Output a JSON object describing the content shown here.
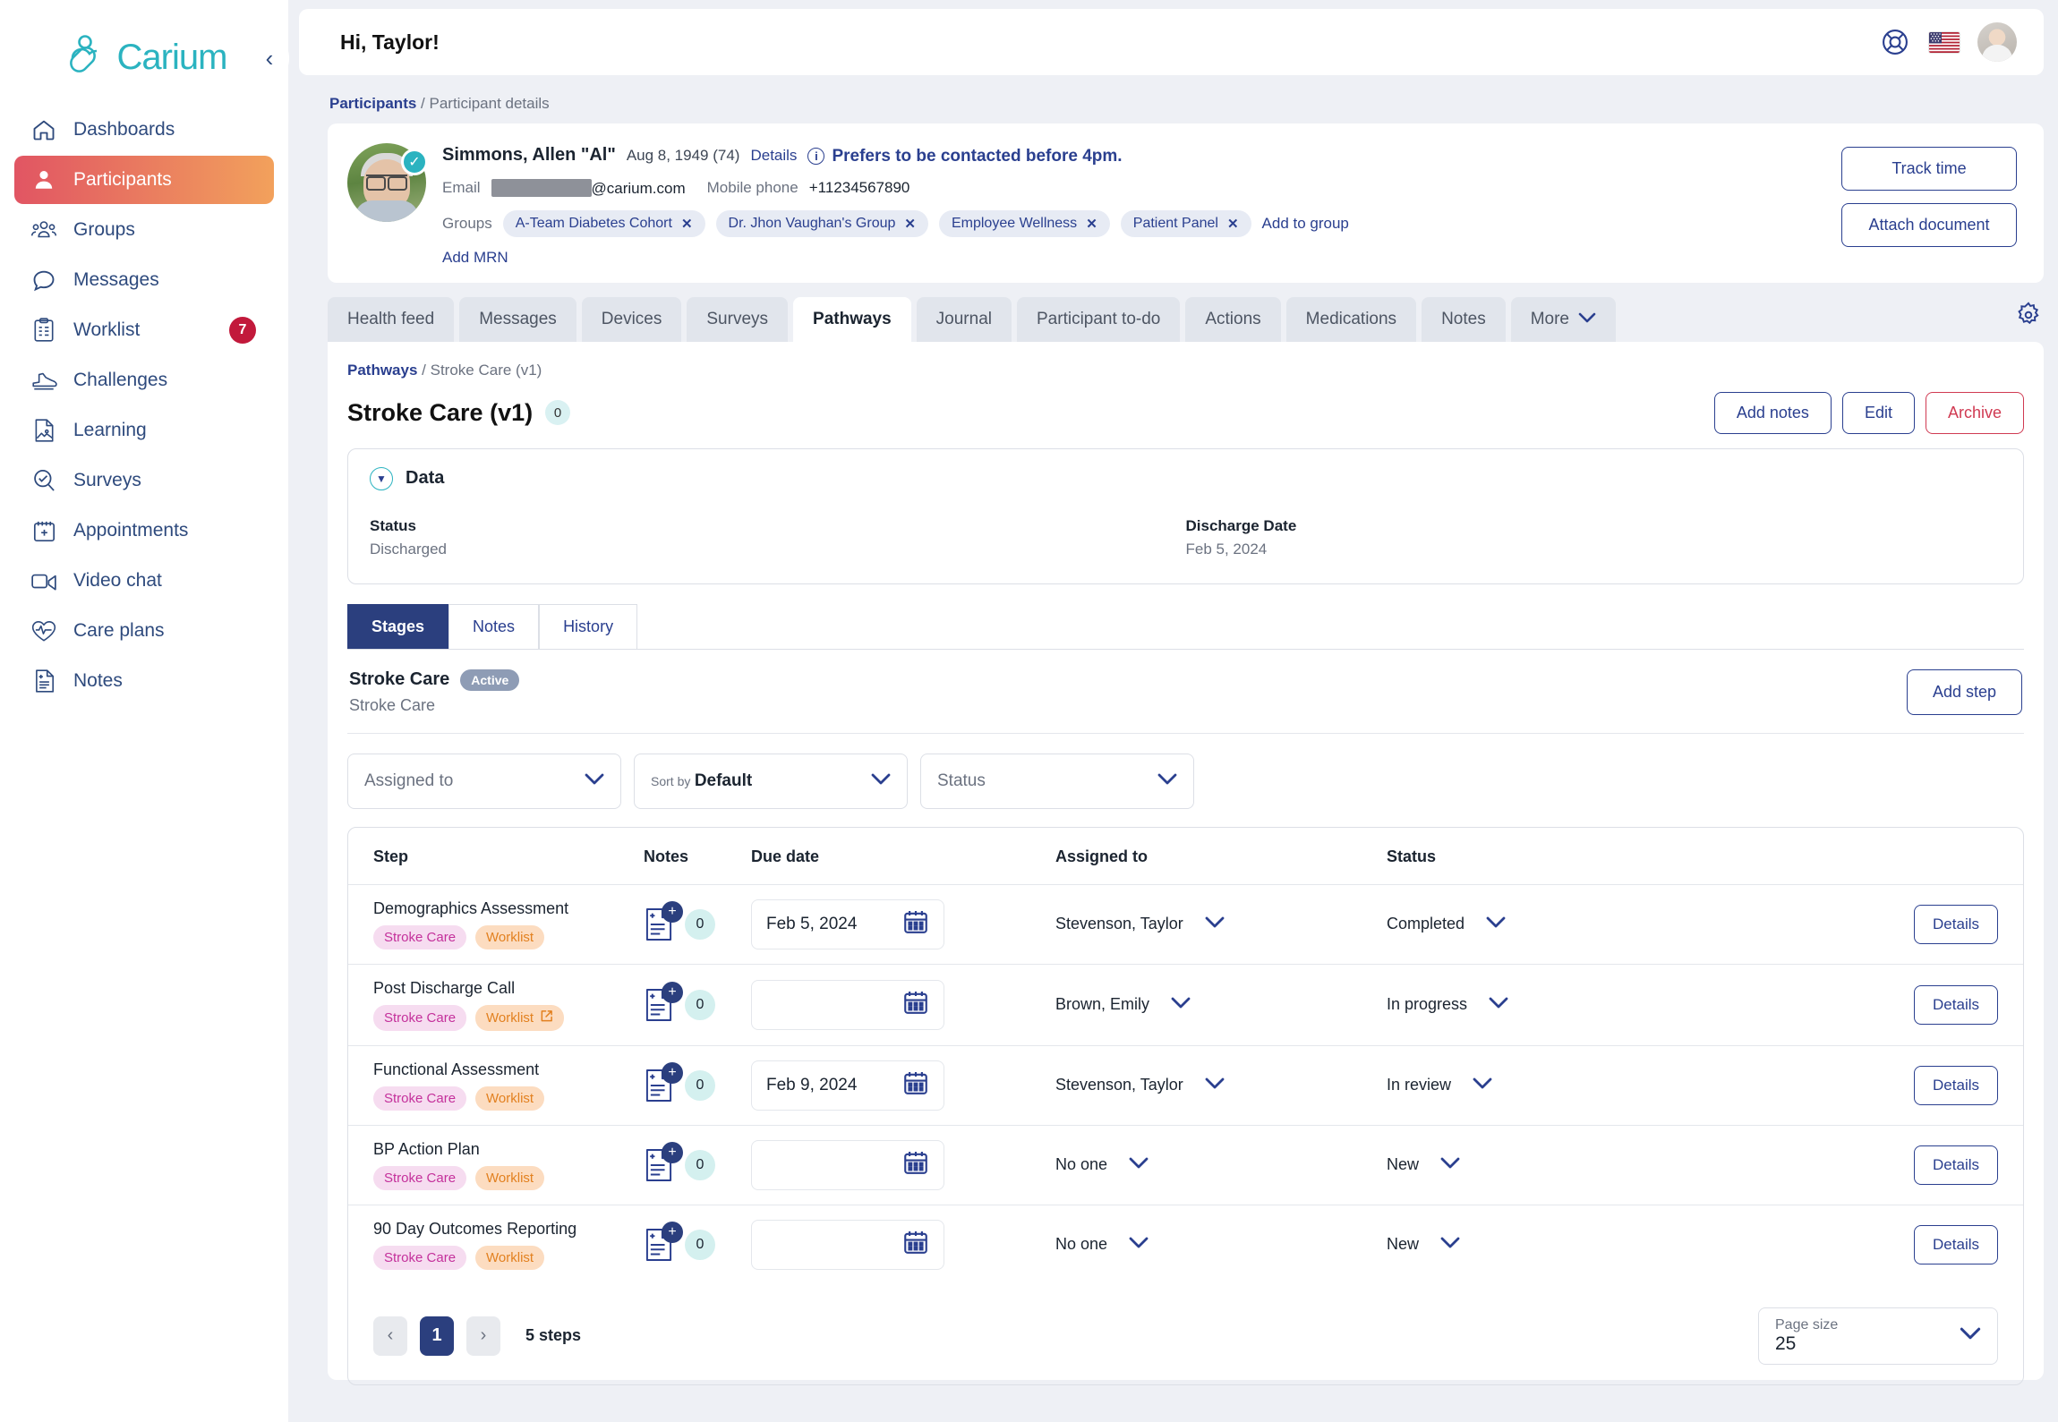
{
  "brand": {
    "name": "Carium",
    "accent": "#2bb3c0",
    "primary": "#2a3f8f",
    "danger": "#d03a52"
  },
  "sidebar": {
    "items": [
      {
        "label": "Dashboards",
        "icon": "home-icon"
      },
      {
        "label": "Participants",
        "icon": "person-icon",
        "active": true
      },
      {
        "label": "Groups",
        "icon": "people-icon"
      },
      {
        "label": "Messages",
        "icon": "chat-icon"
      },
      {
        "label": "Worklist",
        "icon": "clipboard-icon",
        "badge": "7"
      },
      {
        "label": "Challenges",
        "icon": "shoe-icon"
      },
      {
        "label": "Learning",
        "icon": "learning-icon"
      },
      {
        "label": "Surveys",
        "icon": "survey-icon"
      },
      {
        "label": "Appointments",
        "icon": "calendar-icon"
      },
      {
        "label": "Video chat",
        "icon": "video-icon"
      },
      {
        "label": "Care plans",
        "icon": "heart-pulse-icon"
      },
      {
        "label": "Notes",
        "icon": "notes-icon"
      }
    ],
    "collapse_icon": "chevron-left-icon"
  },
  "topbar": {
    "greeting": "Hi, Taylor!",
    "support_icon": "lifebuoy-icon",
    "language_icon": "us-flag-icon",
    "avatar_icon": "user-avatar"
  },
  "breadcrumb": {
    "root": "Participants",
    "sep": "/",
    "current": "Participant details"
  },
  "participant": {
    "name": "Simmons, Allen \"Al\"",
    "dob": "Aug 8, 1949 (74)",
    "details_link": "Details",
    "alert": "Prefers to be contacted before 4pm.",
    "email_label": "Email",
    "email_value": "@carium.com",
    "phone_label": "Mobile phone",
    "phone_value": "+11234567890",
    "groups_label": "Groups",
    "groups": [
      "A-Team Diabetes Cohort",
      "Dr. Jhon Vaughan's Group",
      "Employee Wellness",
      "Patient Panel"
    ],
    "add_to_group": "Add to group",
    "add_mrn": "Add MRN",
    "actions": [
      "Track time",
      "Attach document"
    ]
  },
  "tabs": [
    {
      "label": "Health feed"
    },
    {
      "label": "Messages"
    },
    {
      "label": "Devices"
    },
    {
      "label": "Surveys"
    },
    {
      "label": "Pathways",
      "active": true
    },
    {
      "label": "Journal"
    },
    {
      "label": "Participant to-do"
    },
    {
      "label": "Actions"
    },
    {
      "label": "Medications"
    },
    {
      "label": "Notes"
    },
    {
      "label": "More",
      "caret": true
    }
  ],
  "settings_icon": "gear-icon",
  "pathway": {
    "breadcrumb_root": "Pathways",
    "breadcrumb_sep": "/",
    "breadcrumb_current": "Stroke Care (v1)",
    "title": "Stroke Care (v1)",
    "count": "0",
    "actions": [
      {
        "label": "Add notes",
        "style": "outline"
      },
      {
        "label": "Edit",
        "style": "outline"
      },
      {
        "label": "Archive",
        "style": "danger"
      }
    ]
  },
  "data_section": {
    "title": "Data",
    "toggle_icon": "caret-down-icon",
    "fields": [
      {
        "key": "Status",
        "value": "Discharged"
      },
      {
        "key": "Discharge Date",
        "value": "Feb 5, 2024"
      }
    ]
  },
  "subtabs": [
    {
      "label": "Stages",
      "active": true
    },
    {
      "label": "Notes"
    },
    {
      "label": "History"
    }
  ],
  "stage": {
    "name": "Stroke Care",
    "badge": "Active",
    "subtitle": "Stroke Care",
    "add_step": "Add step"
  },
  "filters": [
    {
      "name": "assigned-to",
      "placeholder": "Assigned to",
      "value": ""
    },
    {
      "name": "sort-by",
      "label": "Sort by",
      "value": "Default"
    },
    {
      "name": "status",
      "placeholder": "Status",
      "value": ""
    }
  ],
  "table": {
    "columns": [
      "Step",
      "Notes",
      "Due date",
      "Assigned to",
      "Status",
      ""
    ],
    "rows": [
      {
        "step": "Demographics Assessment",
        "tags": [
          {
            "text": "Stroke Care",
            "color": "pink"
          },
          {
            "text": "Worklist",
            "color": "orange"
          }
        ],
        "notes_count": "0",
        "due_date": "Feb 5, 2024",
        "assigned_to": "Stevenson, Taylor",
        "status": "Completed",
        "details": "Details"
      },
      {
        "step": "Post Discharge Call",
        "tags": [
          {
            "text": "Stroke Care",
            "color": "pink"
          },
          {
            "text": "Worklist",
            "color": "orange",
            "external": true
          }
        ],
        "notes_count": "0",
        "due_date": "",
        "assigned_to": "Brown, Emily",
        "status": "In progress",
        "details": "Details"
      },
      {
        "step": "Functional Assessment",
        "tags": [
          {
            "text": "Stroke Care",
            "color": "pink"
          },
          {
            "text": "Worklist",
            "color": "orange"
          }
        ],
        "notes_count": "0",
        "due_date": "Feb 9, 2024",
        "assigned_to": "Stevenson, Taylor",
        "status": "In review",
        "details": "Details"
      },
      {
        "step": "BP Action Plan",
        "tags": [
          {
            "text": "Stroke Care",
            "color": "pink"
          },
          {
            "text": "Worklist",
            "color": "orange"
          }
        ],
        "notes_count": "0",
        "due_date": "",
        "assigned_to": "No one",
        "status": "New",
        "details": "Details"
      },
      {
        "step": "90 Day Outcomes Reporting",
        "tags": [
          {
            "text": "Stroke Care",
            "color": "pink"
          },
          {
            "text": "Worklist",
            "color": "orange"
          }
        ],
        "notes_count": "0",
        "due_date": "",
        "assigned_to": "No one",
        "status": "New",
        "details": "Details"
      }
    ]
  },
  "pagination": {
    "prev": "‹",
    "next": "›",
    "current_page": "1",
    "total_label": "5 steps",
    "page_size_label": "Page size",
    "page_size_value": "25"
  }
}
